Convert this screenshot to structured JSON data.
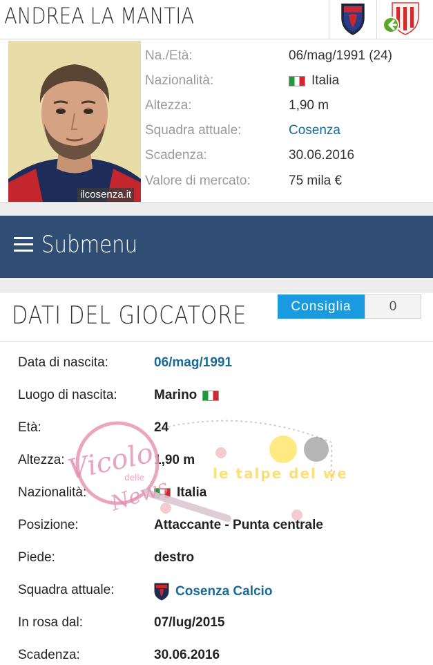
{
  "header": {
    "player_name": "ANDREA LA MANTIA"
  },
  "profile": {
    "photo_watermark": "ilcosenza.it",
    "rows": [
      {
        "label": "Na./Età:",
        "value": "06/mag/1991 (24)"
      },
      {
        "label": "Nazionalità:",
        "value": "Italia",
        "flag": "italy-flag"
      },
      {
        "label": "Altezza:",
        "value": "1,90 m"
      },
      {
        "label": "Squadra attuale:",
        "value": "Cosenza",
        "link": true
      },
      {
        "label": "Scadenza:",
        "value": "30.06.2016"
      },
      {
        "label": "Valore di mercato:",
        "value": "75 mila €"
      }
    ]
  },
  "submenu": {
    "label": "Submenu",
    "icon": "hamburger-menu-icon"
  },
  "player_data": {
    "title": "DATI DEL GIOCATORE",
    "like_label": "Consiglia",
    "like_count": "0",
    "rows": [
      {
        "label": "Data di nascita:",
        "value": "06/mag/1991",
        "link": true
      },
      {
        "label": "Luogo di nascita:",
        "value": "Marino",
        "flag": "italy-flag"
      },
      {
        "label": "Età:",
        "value": "24"
      },
      {
        "label": "Altezza:",
        "value": "1,90 m"
      },
      {
        "label": "Nazionalità:",
        "value": "Italia",
        "flag": "italy-flag"
      },
      {
        "label": "Posizione:",
        "value": "Attaccante - Punta centrale"
      },
      {
        "label": "Piede:",
        "value": "destro"
      },
      {
        "label": "Squadra attuale:",
        "value": "Cosenza Calcio",
        "link": true,
        "icon": "club-shield-icon"
      },
      {
        "label": "In rosa dal:",
        "value": "07/lug/2015"
      },
      {
        "label": "Scadenza:",
        "value": "30.06.2016"
      }
    ]
  },
  "watermark": {
    "magnifier_text_1": "Vicolo",
    "magnifier_text_2": "delle",
    "magnifier_text_3": "News",
    "banner_text": "le talpe del web"
  },
  "colors": {
    "submenu_bg": "#304e73",
    "link": "#1a6a96",
    "like_button": "#1a9be0"
  }
}
